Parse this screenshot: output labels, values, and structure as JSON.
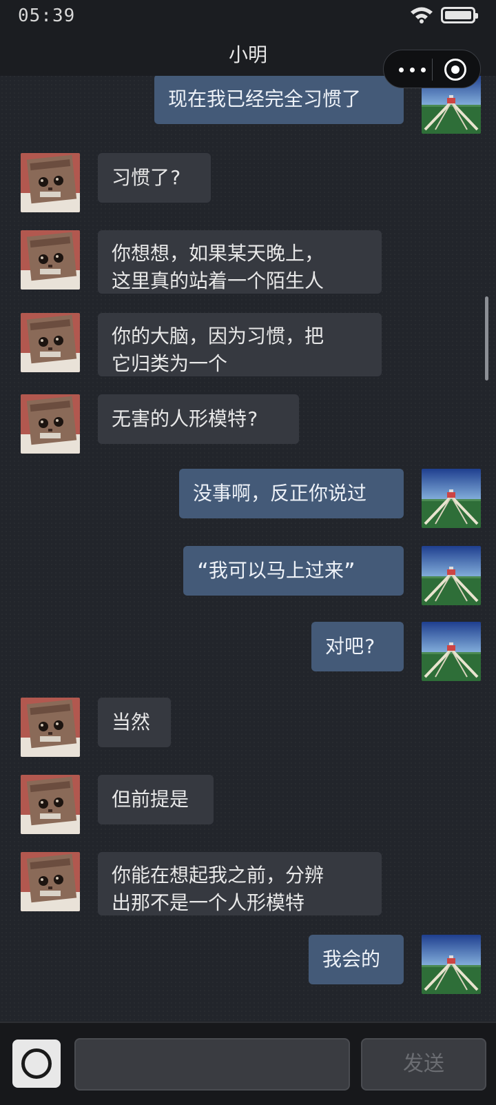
{
  "status_bar": {
    "time": "05:39"
  },
  "nav": {
    "title": "小明"
  },
  "messages": [
    {
      "side": "right",
      "text": "现在我已经完全习惯了"
    },
    {
      "side": "left",
      "text": "习惯了?"
    },
    {
      "side": "left",
      "text": "你想想，如果某天晚上，\n这里真的站着一个陌生人"
    },
    {
      "side": "left",
      "text": "你的大脑，因为习惯，把\n它归类为一个"
    },
    {
      "side": "left",
      "text": "无害的人形模特?"
    },
    {
      "side": "right",
      "text": "没事啊，反正你说过"
    },
    {
      "side": "right",
      "text": "“我可以马上过来”"
    },
    {
      "side": "right",
      "text": "对吧?"
    },
    {
      "side": "left",
      "text": "当然"
    },
    {
      "side": "left",
      "text": "但前提是"
    },
    {
      "side": "left",
      "text": "你能在想起我之前，分辨\n出那不是一个人形模特"
    },
    {
      "side": "right",
      "text": "我会的"
    }
  ],
  "input": {
    "placeholder": "",
    "send_label": "发送"
  },
  "icons": {
    "wifi": "wifi-icon",
    "battery": "battery-icon",
    "more": "more-dots-icon",
    "close": "circle-target-icon",
    "camera": "camera-icon",
    "contact_avatar": "cat-avatar",
    "self_avatar": "pixel-landscape-avatar"
  }
}
